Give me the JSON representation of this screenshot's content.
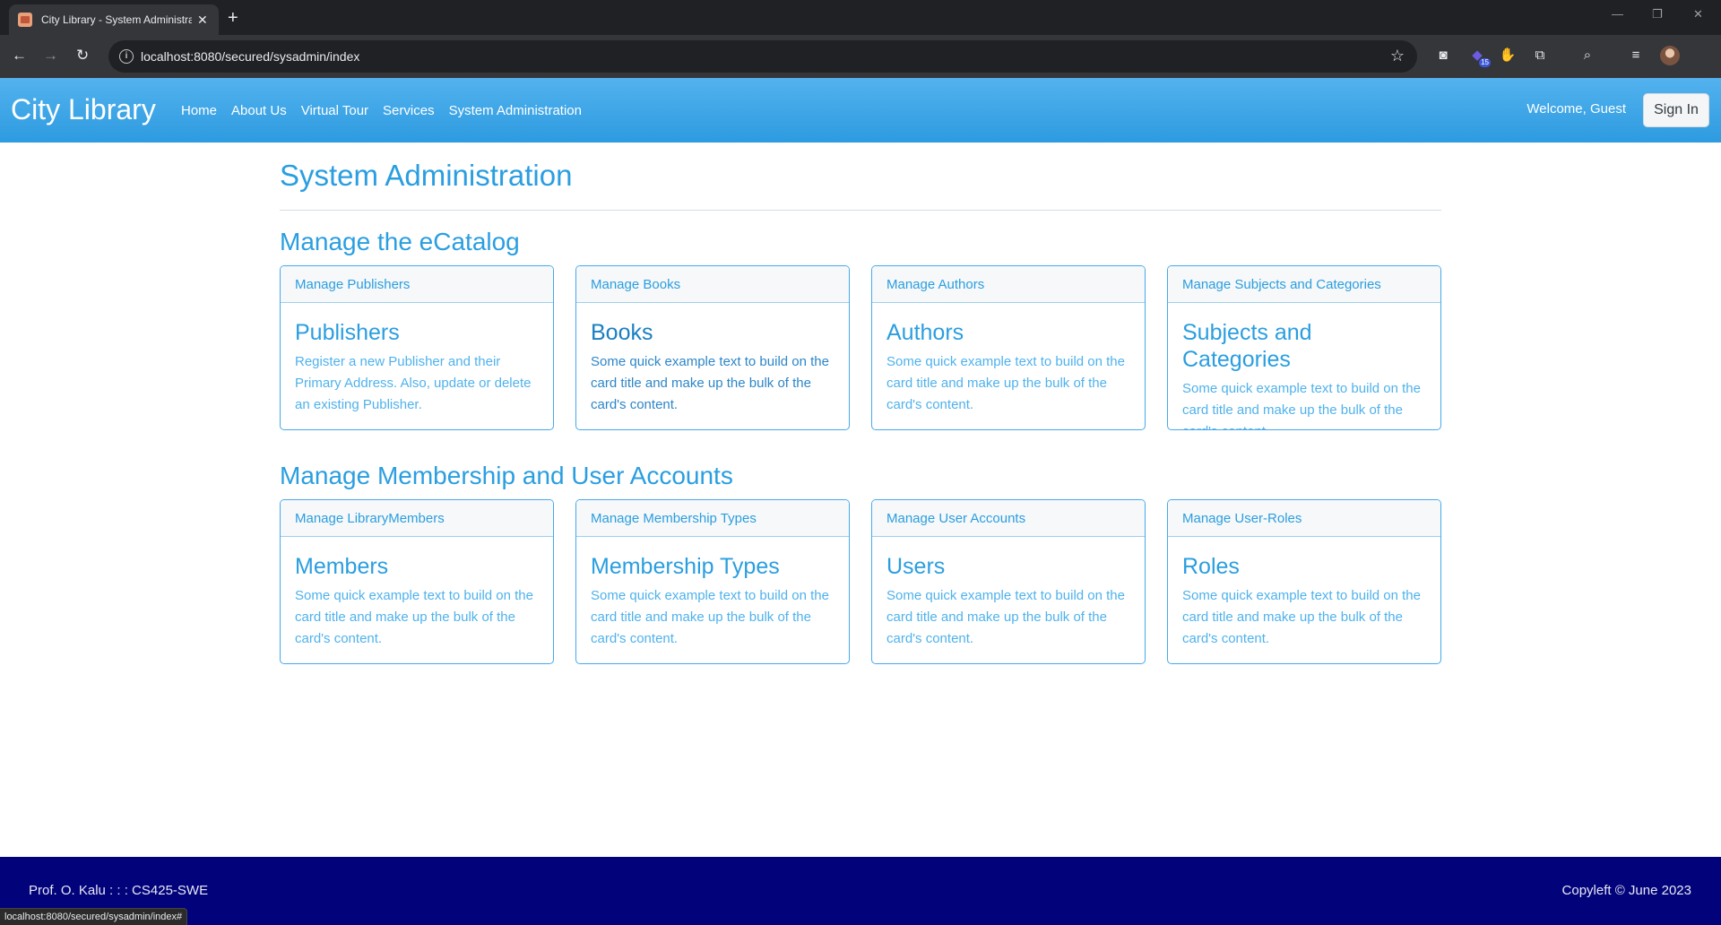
{
  "browser": {
    "tab_title": "City Library - System Administration",
    "tab_close": "✕",
    "new_tab": "+",
    "url": "localhost:8080/secured/sysadmin/index",
    "status_url": "localhost:8080/secured/sysadmin/index#",
    "glyphs": {
      "back": "←",
      "forward": "→",
      "reload": "↻",
      "info": "i",
      "star": "☆",
      "minimize": "—",
      "restore": "❐",
      "close": "✕",
      "screenshot_ext": "◙",
      "ext_badge_icon": "◆",
      "ext_badge_count": "15",
      "red_ext": "✋",
      "extensions": "⧉",
      "tab_search": "⌕",
      "reading_list": "≡"
    }
  },
  "navbar": {
    "brand": "City Library",
    "links": [
      "Home",
      "About Us",
      "Virtual Tour",
      "Services",
      "System Administration"
    ],
    "welcome": "Welcome, Guest",
    "signin": "Sign In"
  },
  "page": {
    "title": "System Administration",
    "sections": [
      {
        "title": "Manage the eCatalog",
        "cards": [
          {
            "header": "Manage Publishers",
            "title": "Publishers",
            "text": "Register a new Publisher and their Primary Address. Also, update or delete an existing Publisher."
          },
          {
            "header": "Manage Books",
            "title": "Books",
            "text": "Some quick example text to build on the card title and make up the bulk of the card's content."
          },
          {
            "header": "Manage Authors",
            "title": "Authors",
            "text": "Some quick example text to build on the card title and make up the bulk of the card's content."
          },
          {
            "header": "Manage Subjects and Categories",
            "title": "Subjects and Categories",
            "text": "Some quick example text to build on the card title and make up the bulk of the card's content."
          }
        ]
      },
      {
        "title": "Manage Membership and User Accounts",
        "cards": [
          {
            "header": "Manage LibraryMembers",
            "title": "Members",
            "text": "Some quick example text to build on the card title and make up the bulk of the card's content."
          },
          {
            "header": "Manage Membership Types",
            "title": "Membership Types",
            "text": "Some quick example text to build on the card title and make up the bulk of the card's content."
          },
          {
            "header": "Manage User Accounts",
            "title": "Users",
            "text": "Some quick example text to build on the card title and make up the bulk of the card's content."
          },
          {
            "header": "Manage User-Roles",
            "title": "Roles",
            "text": "Some quick example text to build on the card title and make up the bulk of the card's content."
          }
        ]
      }
    ]
  },
  "footer": {
    "left": "Prof. O. Kalu : : : CS425-SWE",
    "right": "Copyleft © June 2023"
  },
  "colors": {
    "navbar_top": "#53b2ee",
    "navbar_bottom": "#2d9be0",
    "heading": "#2a9ee0",
    "card_border": "#45aaeb",
    "footer": "#02027a"
  }
}
